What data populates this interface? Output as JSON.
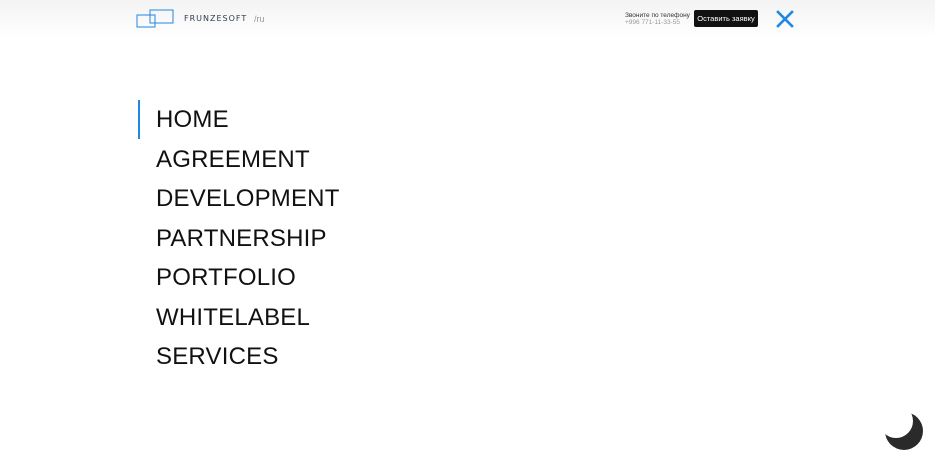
{
  "header": {
    "logo_text": "FRUNZESOFT",
    "lang": "/ru",
    "phone_label": "Звоните по телефону",
    "phone_number": "+996 771-11-33-55",
    "request_button": "Оставить заявку"
  },
  "menu": {
    "items": [
      {
        "label": "HOME",
        "active": true
      },
      {
        "label": "AGREEMENT"
      },
      {
        "label": "DEVELOPMENT"
      },
      {
        "label": "PARTNERSHIP"
      },
      {
        "label": "PORTFOLIO"
      },
      {
        "label": "WHITELABEL"
      },
      {
        "label": "SERVICES"
      }
    ]
  },
  "colors": {
    "accent": "#1e88e5",
    "text": "#111111",
    "button_bg": "#111111",
    "close_icon": "#1e88e5",
    "theme_toggle": "#2a2a2a"
  },
  "icons": {
    "logo": "logo-mark-icon",
    "close": "close-icon",
    "theme": "moon-icon"
  }
}
